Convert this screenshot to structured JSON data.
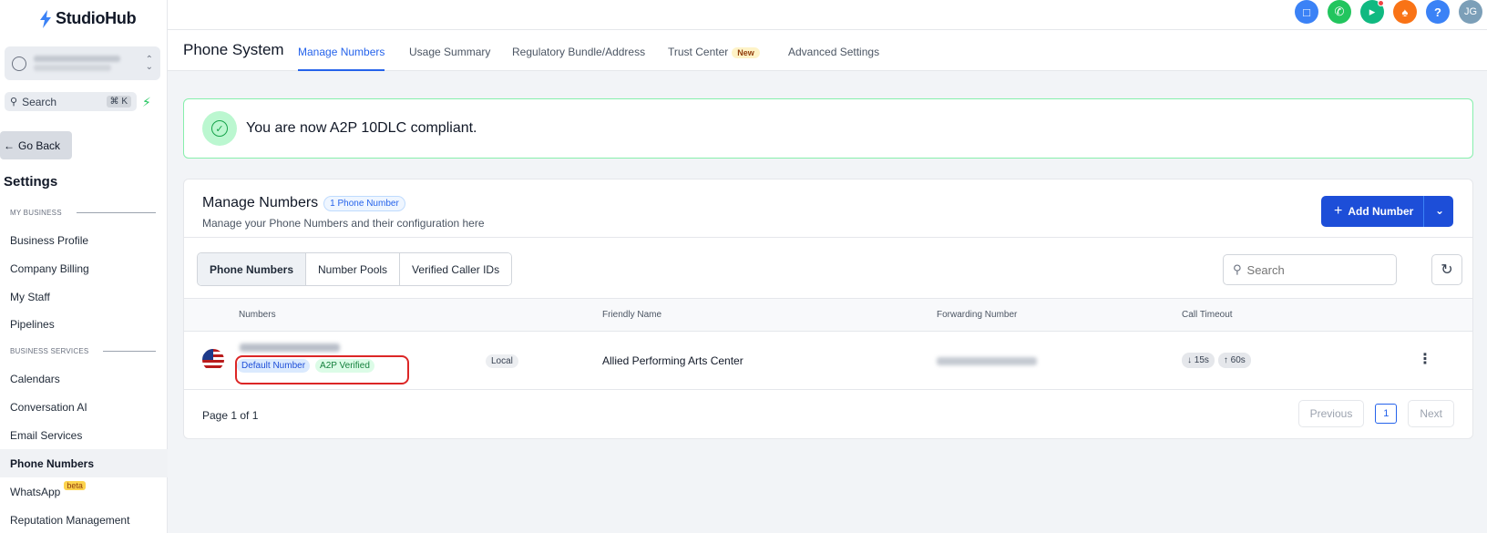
{
  "app": {
    "name": "StudioHub"
  },
  "sidebar": {
    "search_label": "Search",
    "search_shortcut": "⌘ K",
    "go_back": "Go Back",
    "settings_title": "Settings",
    "sections": {
      "my_business": "MY BUSINESS",
      "business_services": "BUSINESS SERVICES"
    },
    "items": [
      {
        "label": "Business Profile"
      },
      {
        "label": "Company Billing"
      },
      {
        "label": "My Staff"
      },
      {
        "label": "Pipelines"
      },
      {
        "label": "Calendars"
      },
      {
        "label": "Conversation AI"
      },
      {
        "label": "Email Services"
      },
      {
        "label": "Phone Numbers",
        "active": true
      },
      {
        "label": "WhatsApp",
        "badge": "beta"
      },
      {
        "label": "Reputation Management"
      }
    ]
  },
  "topbar": {
    "avatar_initials": "JG",
    "help_label": "?",
    "icon_colors": {
      "chat": "#3b82f6",
      "phone": "#22c55e",
      "megaphone": "#10b981",
      "bell": "#f97316",
      "help": "#3b82f6",
      "avatar": "#7c9fb8"
    }
  },
  "header": {
    "title": "Phone System",
    "tabs": [
      {
        "label": "Manage Numbers",
        "active": true
      },
      {
        "label": "Usage Summary"
      },
      {
        "label": "Regulatory Bundle/Address"
      },
      {
        "label": "Trust Center",
        "badge": "New"
      },
      {
        "label": "Advanced Settings"
      }
    ]
  },
  "banner": {
    "text": "You are now A2P 10DLC compliant."
  },
  "card": {
    "title": "Manage Numbers",
    "count_badge": "1 Phone Number",
    "subtitle": "Manage your Phone Numbers and their configuration here",
    "add_button": "Add Number",
    "segments": [
      {
        "label": "Phone Numbers",
        "active": true
      },
      {
        "label": "Number Pools"
      },
      {
        "label": "Verified Caller IDs"
      }
    ],
    "search_placeholder": "Search",
    "columns": [
      "Numbers",
      "Friendly Name",
      "Forwarding Number",
      "Call Timeout"
    ],
    "rows": [
      {
        "tags": [
          "Default Number",
          "A2P Verified"
        ],
        "type": "Local",
        "friendly_name": "Allied Performing Arts Center",
        "timeout_in": "↓ 15s",
        "timeout_out": "↑ 60s"
      }
    ],
    "pagination": {
      "info": "Page 1 of 1",
      "previous": "Previous",
      "current": "1",
      "next": "Next"
    }
  },
  "colors": {
    "accent": "#2563eb",
    "primary_button": "#1d4ed8",
    "success": "#16a34a",
    "highlight": "#dc2626"
  }
}
